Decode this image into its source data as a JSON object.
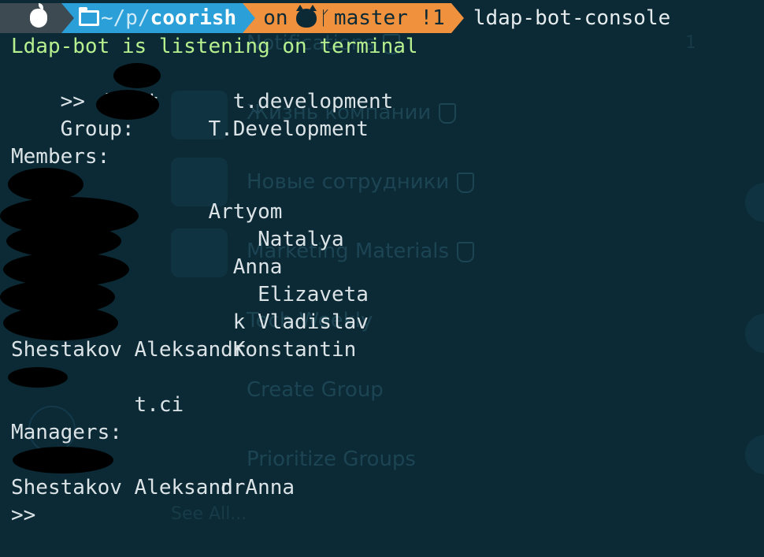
{
  "prompt": {
    "dir_prefix": "~/p/",
    "dir_name": "coorish",
    "git_on": "on",
    "git_branch": "master !1",
    "window_title": "ldap-bot-console"
  },
  "terminal": {
    "status": "Ldap-bot is listening on terminal",
    "command": ">> /list      t.development",
    "group": "Group:      T.Development",
    "members_header": "Members:",
    "members": [
      "            Artyom",
      "                Natalya",
      "              Anna",
      "                Elizaveta",
      "              k Vladislav",
      "              Konstantin",
      "Shestakov Aleksandr",
      "      t.ci"
    ],
    "managers_header": "Managers:",
    "managers": [
      "             n Anna",
      "Shestakov Aleksandr"
    ],
    "next_prompt": ">>"
  },
  "background_app": {
    "groups": [
      "Notifications",
      "Жизнь компании",
      "Новые сотрудники",
      "Marketing Materials",
      "Tech Weekly",
      "Create Group",
      "Prioritize Groups"
    ],
    "see_all": "See All...",
    "count": "1"
  },
  "colors": {
    "terminal_bg": "#0b2a36",
    "apple_segment": "#3e4a52",
    "dir_segment": "#2b9fd8",
    "git_segment": "#f0913e",
    "status_text": "#b7f08e",
    "text": "#dbe3e6"
  }
}
